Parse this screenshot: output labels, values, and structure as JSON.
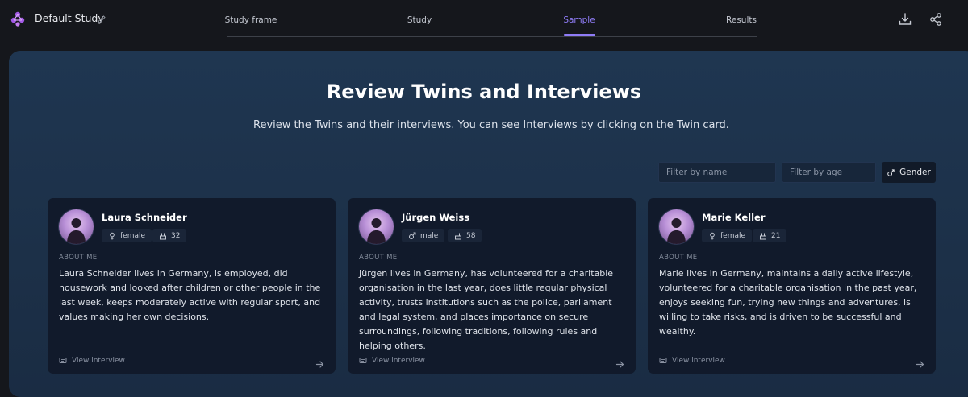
{
  "header": {
    "study_name": "Default Study",
    "tabs": [
      {
        "label": "Study frame"
      },
      {
        "label": "Study"
      },
      {
        "label": "Sample"
      },
      {
        "label": "Results"
      }
    ],
    "active_tab": "Sample"
  },
  "main": {
    "title": "Review Twins and Interviews",
    "subtitle": "Review the Twins and their interviews. You can see Interviews by clicking on the Twin card.",
    "filters": {
      "name_placeholder": "Filter by name",
      "age_placeholder": "Filter by age",
      "gender_label": "Gender"
    },
    "cards": [
      {
        "name": "Laura Schneider",
        "gender": "female",
        "age": "32",
        "about_label": "ABOUT ME",
        "about": "Laura Schneider lives in Germany, is employed, did housework and looked after children or other people in the last week, keeps moderately active with regular sport, and values making her own decisions.",
        "view_label": "View interview"
      },
      {
        "name": "Jürgen Weiss",
        "gender": "male",
        "age": "58",
        "about_label": "ABOUT ME",
        "about": "Jürgen lives in Germany, has volunteered for a charitable organisation in the last year, does little regular physical activity, trusts institutions such as the police, parliament and legal system, and places importance on secure surroundings, following traditions, following rules and helping others.",
        "view_label": "View interview"
      },
      {
        "name": "Marie Keller",
        "gender": "female",
        "age": "21",
        "about_label": "ABOUT ME",
        "about": "Marie lives in Germany, maintains a daily active lifestyle, volunteered for a charitable organisation in the past year, enjoys seeking fun, trying new things and adventures, is willing to take risks, and is driven to be successful and wealthy.",
        "view_label": "View interview"
      }
    ]
  },
  "colors": {
    "accent": "#8f7cf6",
    "panel": "#1f3651",
    "card": "#111a2b"
  }
}
